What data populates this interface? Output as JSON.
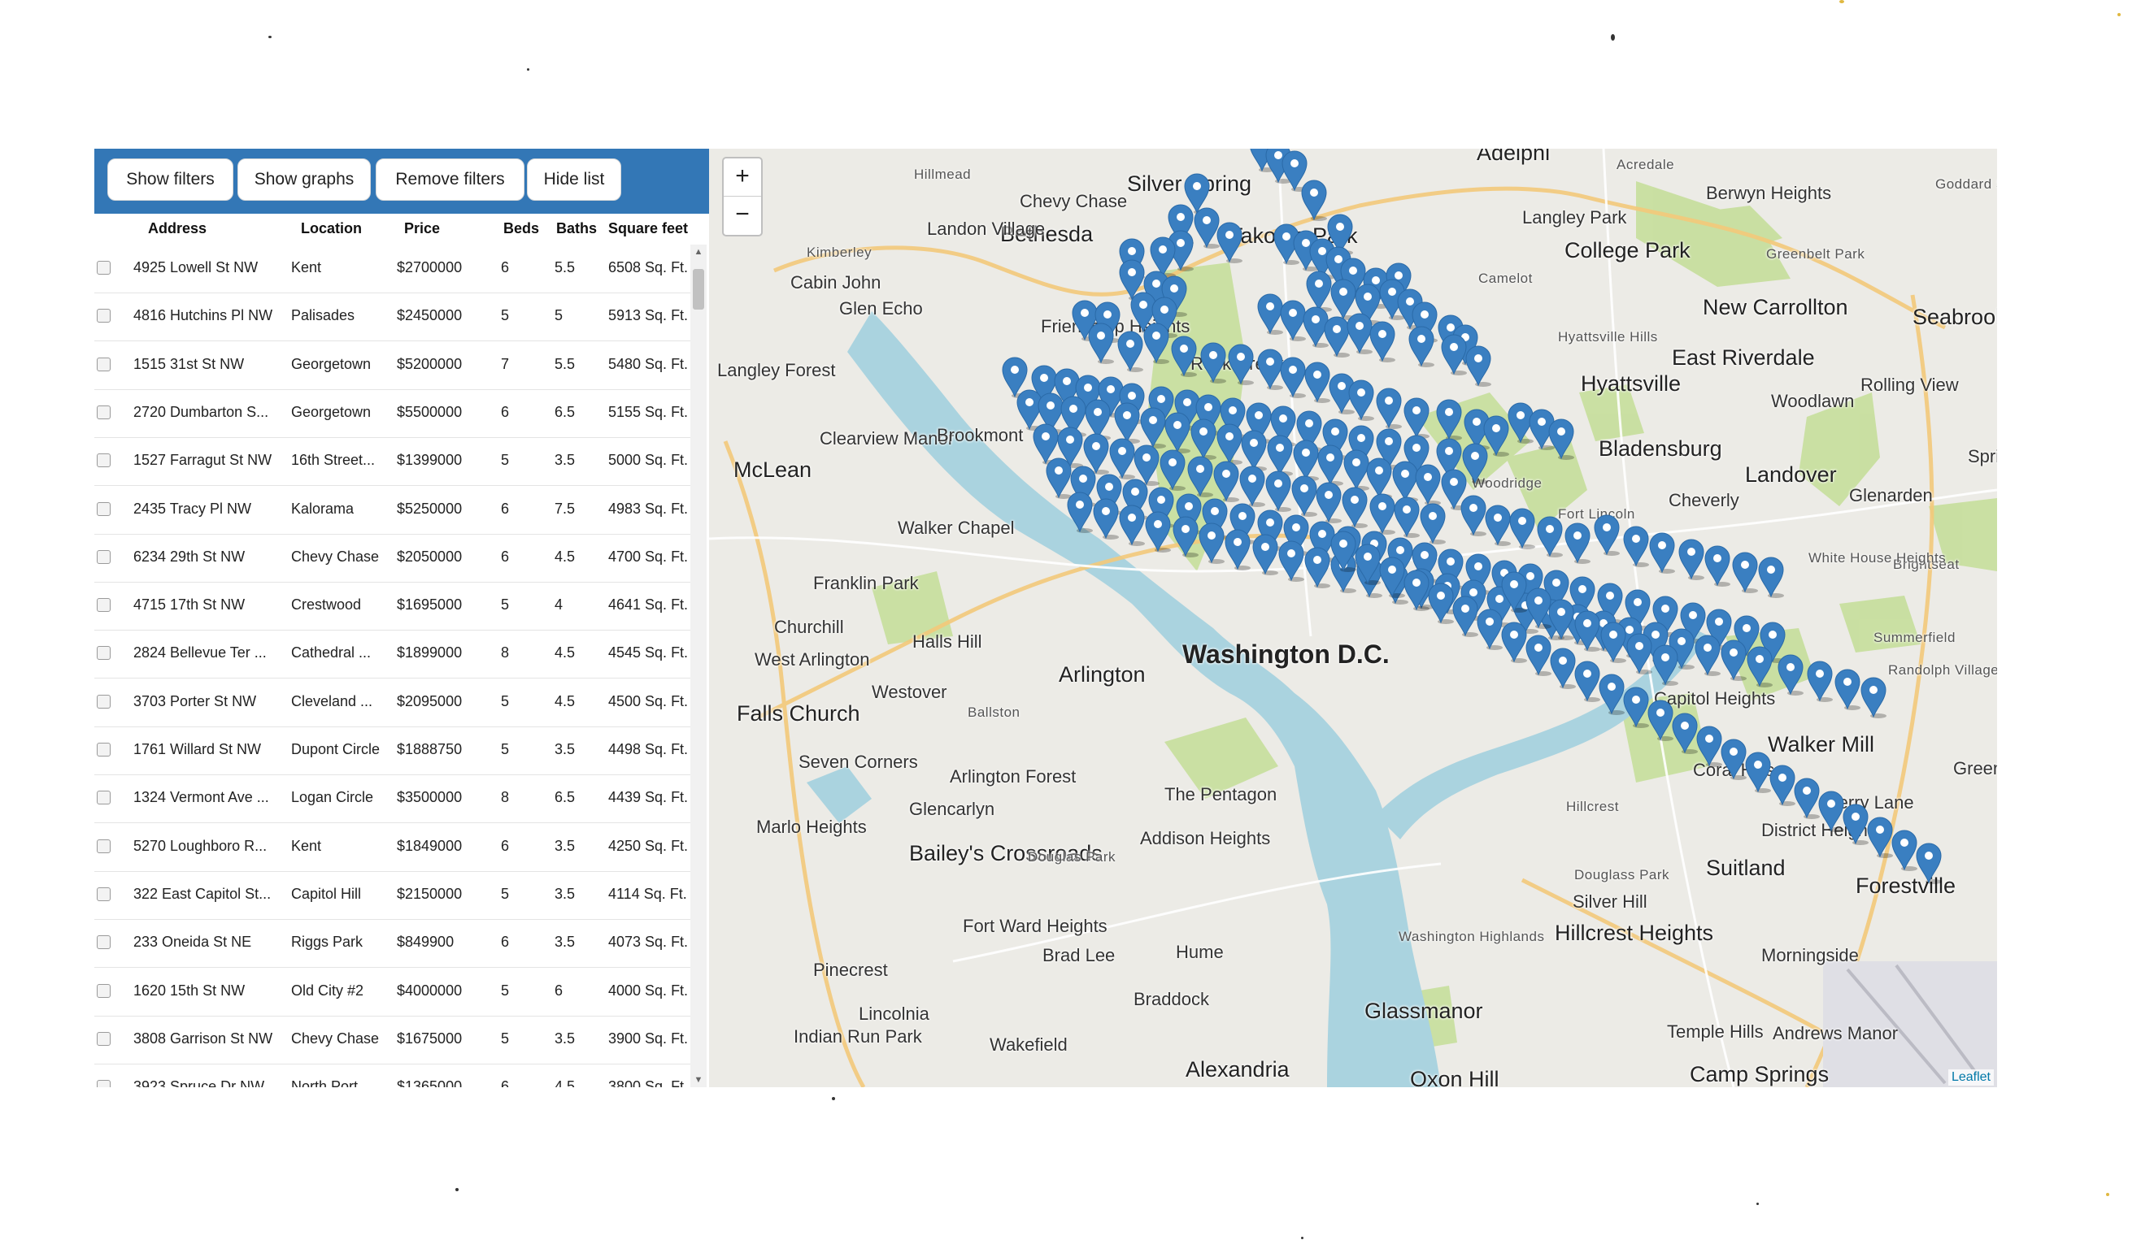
{
  "toolbar": {
    "buttons": [
      "Show filters",
      "Show graphs",
      "Remove filters",
      "Hide list"
    ]
  },
  "table": {
    "columns": [
      "Address",
      "Location",
      "Price",
      "Beds",
      "Baths",
      "Square feet"
    ],
    "rows": [
      [
        "4925 Lowell St NW",
        "Kent",
        "$2700000",
        "6",
        "5.5",
        "6508 Sq. Ft."
      ],
      [
        "4816 Hutchins Pl NW",
        "Palisades",
        "$2450000",
        "5",
        "5",
        "5913 Sq. Ft."
      ],
      [
        "1515 31st St NW",
        "Georgetown",
        "$5200000",
        "7",
        "5.5",
        "5480 Sq. Ft."
      ],
      [
        "2720 Dumbarton S...",
        "Georgetown",
        "$5500000",
        "6",
        "6.5",
        "5155 Sq. Ft."
      ],
      [
        "1527 Farragut St NW",
        "16th Street...",
        "$1399000",
        "5",
        "3.5",
        "5000 Sq. Ft."
      ],
      [
        "2435 Tracy Pl NW",
        "Kalorama",
        "$5250000",
        "6",
        "7.5",
        "4983 Sq. Ft."
      ],
      [
        "6234 29th St NW",
        "Chevy Chase",
        "$2050000",
        "6",
        "4.5",
        "4700 Sq. Ft."
      ],
      [
        "4715 17th St NW",
        "Crestwood",
        "$1695000",
        "5",
        "4",
        "4641 Sq. Ft."
      ],
      [
        "2824 Bellevue Ter ...",
        "Cathedral ...",
        "$1899000",
        "8",
        "4.5",
        "4545 Sq. Ft."
      ],
      [
        "3703 Porter St NW",
        "Cleveland ...",
        "$2095000",
        "5",
        "4.5",
        "4500 Sq. Ft."
      ],
      [
        "1761 Willard St NW",
        "Dupont Circle",
        "$1888750",
        "5",
        "3.5",
        "4498 Sq. Ft."
      ],
      [
        "1324 Vermont Ave ...",
        "Logan Circle",
        "$3500000",
        "8",
        "6.5",
        "4439 Sq. Ft."
      ],
      [
        "5270 Loughboro R...",
        "Kent",
        "$1849000",
        "6",
        "3.5",
        "4250 Sq. Ft."
      ],
      [
        "322 East Capitol St...",
        "Capitol Hill",
        "$2150000",
        "5",
        "3.5",
        "4114 Sq. Ft."
      ],
      [
        "233 Oneida St NE",
        "Riggs Park",
        "$849900",
        "6",
        "3.5",
        "4073 Sq. Ft."
      ],
      [
        "1620 15th St NW",
        "Old City #2",
        "$4000000",
        "5",
        "6",
        "4000 Sq. Ft."
      ],
      [
        "3808 Garrison St NW",
        "Chevy Chase",
        "$1675000",
        "5",
        "3.5",
        "3900 Sq. Ft."
      ],
      [
        "3923 Spruce Dr NW",
        "North Port",
        "$1365000",
        "6",
        "4.5",
        "3800 Sq. Ft."
      ]
    ]
  },
  "map": {
    "zoom_in": "+",
    "zoom_out": "−",
    "attribution": "Leaflet",
    "marker_color": "#3a7fc1",
    "water_color": "#aad3df",
    "park_color": "#c8df9f",
    "place_labels": [
      "Bethesda",
      "Silver Spring",
      "Takoma Park",
      "College Park",
      "Langley Park",
      "Chevy Chase",
      "Friendship Heights",
      "Glen Echo",
      "Cabin John",
      "Langley Forest",
      "McLean",
      "Clearview Manor",
      "Brookmont",
      "Walker Chapel",
      "Franklin Park",
      "Churchill",
      "West Arlington",
      "Halls Hill",
      "Arlington",
      "Westover",
      "Falls Church",
      "Seven Corners",
      "Arlington Forest",
      "Glencarlyn",
      "Marlo Heights",
      "Bailey's Crossroads",
      "Fort Ward Heights",
      "Pinecrest",
      "Lincolnia",
      "Indian Run Park",
      "Wakefield",
      "Alexandria",
      "Brad Lee",
      "Braddock",
      "Hume",
      "Addison Heights",
      "The Pentagon",
      "Washington D.C.",
      "Glassmanor",
      "Oxon Hill",
      "Hillcrest Heights",
      "Suitland",
      "Silver Hill",
      "Temple Hills",
      "Camp Springs",
      "Andrews Manor",
      "Morningside",
      "District Heights",
      "Forestville",
      "Coral Hills",
      "Walker Mill",
      "Berry Lane",
      "Landover",
      "Cheverly",
      "Bladensburg",
      "Hyattsville",
      "East Riverdale",
      "New Carrollton",
      "Woodlawn",
      "Glenarden",
      "Adelphi",
      "Berwyn Heights",
      "Greenbelt Park",
      "Seabrook",
      "Goddard Space Flight Center",
      "Hillmead",
      "Kimberley",
      "Landon Village",
      "Rock Creek",
      "Acredale",
      "Hyattsville Hills",
      "Rolling View",
      "Springdale",
      "Summerfield",
      "Randolph Village",
      "Brightseat",
      "White House Heights",
      "Woodridge",
      "Fort Lincoln",
      "Capitol Heights",
      "Hillcrest",
      "Douglass Park",
      "Ballston",
      "Douglas Park",
      "Washington Highlands",
      "Camelot",
      "Greenwood"
    ]
  }
}
